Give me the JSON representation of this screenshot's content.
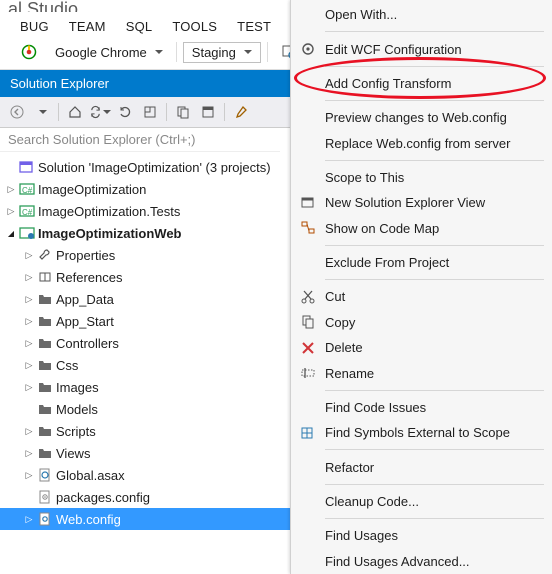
{
  "app_title": "al Studio",
  "menubar": [
    "BUG",
    "TEAM",
    "SQL",
    "TOOLS",
    "TEST"
  ],
  "toolbar": {
    "browser_label": "Google Chrome",
    "config_label": "Staging"
  },
  "solution_explorer": {
    "title": "Solution Explorer",
    "search_placeholder": "Search Solution Explorer (Ctrl+;)",
    "solution_label": "Solution 'ImageOptimization' (3 projects)",
    "nodes": {
      "proj1": "ImageOptimization",
      "proj2": "ImageOptimization.Tests",
      "proj3": "ImageOptimizationWeb",
      "properties": "Properties",
      "references": "References",
      "app_data": "App_Data",
      "app_start": "App_Start",
      "controllers": "Controllers",
      "css": "Css",
      "images": "Images",
      "models": "Models",
      "scripts": "Scripts",
      "views": "Views",
      "global_asax": "Global.asax",
      "packages_config": "packages.config",
      "web_config": "Web.config"
    }
  },
  "context_menu": {
    "open_with": "Open With...",
    "edit_wcf": "Edit WCF Configuration",
    "add_config_transform": "Add Config Transform",
    "preview_changes": "Preview changes to Web.config",
    "replace_webconfig": "Replace Web.config from server",
    "scope_to_this": "Scope to This",
    "new_se_view": "New Solution Explorer View",
    "show_on_codemap": "Show on Code Map",
    "exclude": "Exclude From Project",
    "cut": "Cut",
    "copy": "Copy",
    "delete": "Delete",
    "rename": "Rename",
    "find_code_issues": "Find Code Issues",
    "find_symbols_ext": "Find Symbols External to Scope",
    "refactor": "Refactor",
    "cleanup": "Cleanup Code...",
    "find_usages": "Find Usages",
    "find_usages_adv": "Find Usages Advanced..."
  }
}
